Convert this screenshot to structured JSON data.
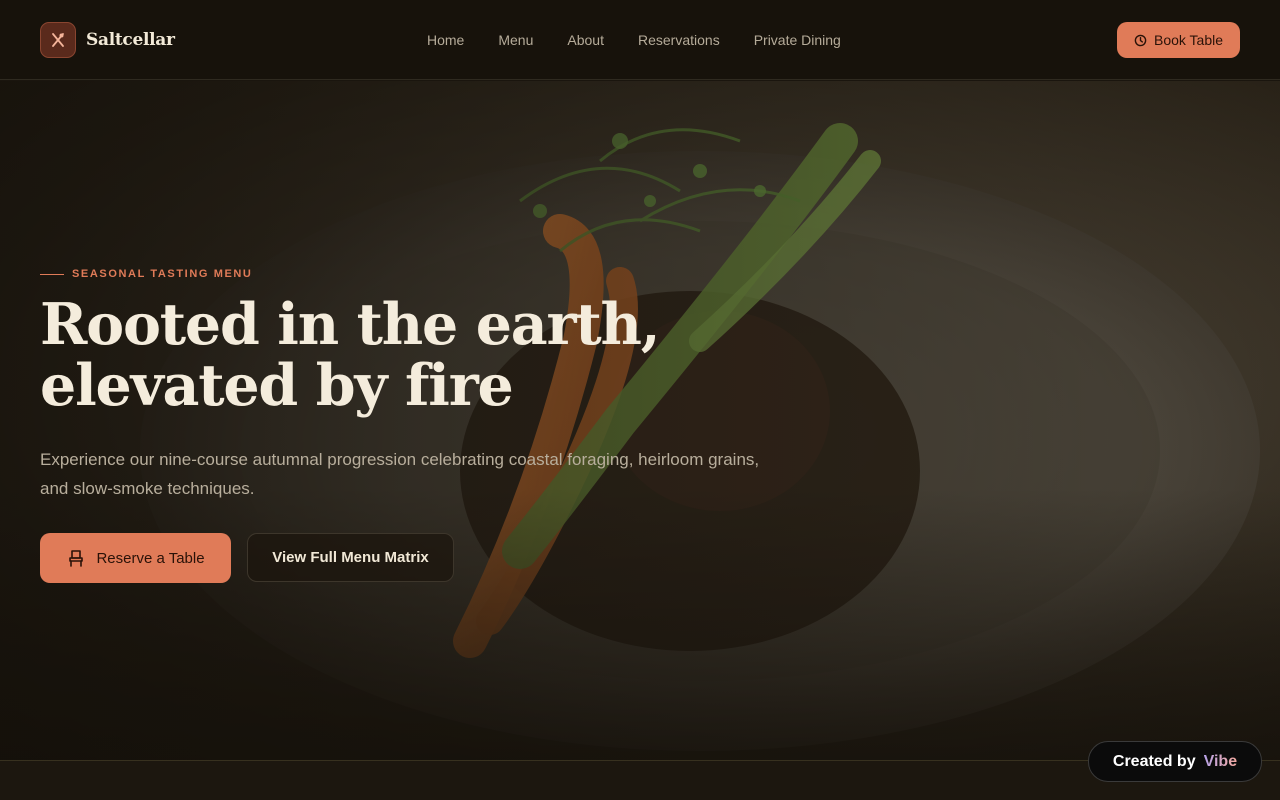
{
  "brand": {
    "name": "Saltcellar",
    "icon": "utensils-icon"
  },
  "nav": {
    "items": [
      "Home",
      "Menu",
      "About",
      "Reservations",
      "Private Dining"
    ]
  },
  "header": {
    "book_label": "Book Table",
    "book_icon": "clock-icon"
  },
  "hero": {
    "eyebrow": "SEASONAL TASTING MENU",
    "title_line1": "Rooted in the earth,",
    "title_line2": "elevated by fire",
    "description": "Experience our nine-course autumnal progression celebrating coastal foraging, heirloom grains, and slow-smoke techniques.",
    "primary_cta": "Reserve a Table",
    "primary_icon": "chair-icon",
    "secondary_cta": "View Full Menu Matrix",
    "background_image": "plated-dish-photo"
  },
  "badge": {
    "prefix": "Created by",
    "brand": "Vibe"
  },
  "colors": {
    "accent": "#e07b58",
    "background": "#17120b",
    "text": "#f4ecdc"
  }
}
